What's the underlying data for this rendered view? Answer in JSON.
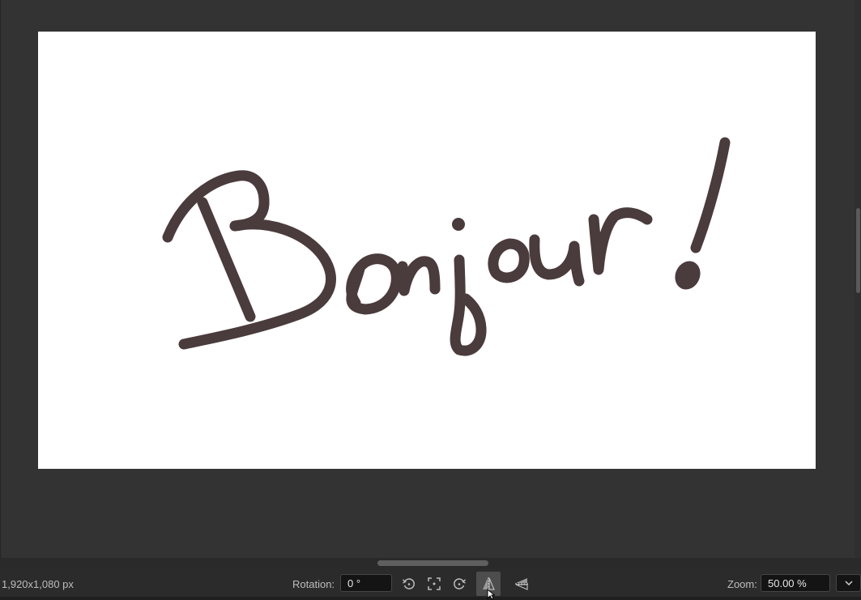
{
  "canvas": {
    "background": "#ffffff",
    "stroke_color": "#4a3b3c",
    "artwork_text": "Bonjour!"
  },
  "statusbar": {
    "document_size": "1,920x1,080 px",
    "rotation_label": "Rotation:",
    "rotation_value": "0 °",
    "zoom_label": "Zoom:",
    "zoom_value": "50.00 %",
    "tools": [
      {
        "name": "rotate-left-icon"
      },
      {
        "name": "fit-to-view-icon"
      },
      {
        "name": "rotate-right-icon"
      },
      {
        "name": "mirror-horizontal-icon",
        "active": true
      },
      {
        "name": "mirror-vertical-icon"
      }
    ]
  },
  "colors": {
    "app_background": "#333333",
    "statusbar": "#2b2b2b",
    "input_background": "#141414",
    "text": "#bdbdbd"
  }
}
